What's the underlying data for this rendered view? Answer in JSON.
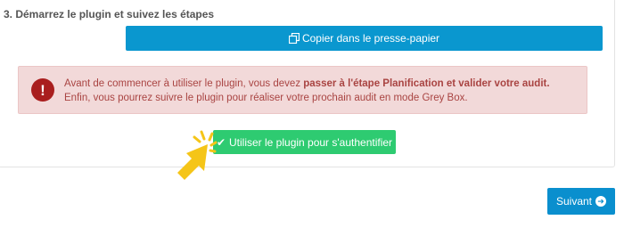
{
  "step": {
    "title": "3. Démarrez le plugin et suivez les étapes"
  },
  "copy_button": {
    "label": "Copier dans le presse-papier",
    "icon": "copy-icon",
    "color": "#0a97cf"
  },
  "alert": {
    "icon": "exclamation-circle-icon",
    "line1_prefix": "Avant de commencer à utiliser le plugin, vous devez ",
    "line1_bold": "passer à l'étape Planification et valider votre audit.",
    "line2": "Enfin, vous pourrez suivre le plugin pour réaliser votre prochain audit en mode Grey Box.",
    "background": "#f2d9d9",
    "text_color": "#a94442"
  },
  "auth_button": {
    "label": "Utiliser le plugin pour s'authentifier",
    "icon": "check-icon",
    "color": "#2ecb71"
  },
  "pointer": {
    "icon": "click-pointer-icon",
    "color": "#f5c518"
  },
  "next_button": {
    "label": "Suivant",
    "icon": "arrow-circle-right-icon",
    "color": "#0a8fce"
  }
}
